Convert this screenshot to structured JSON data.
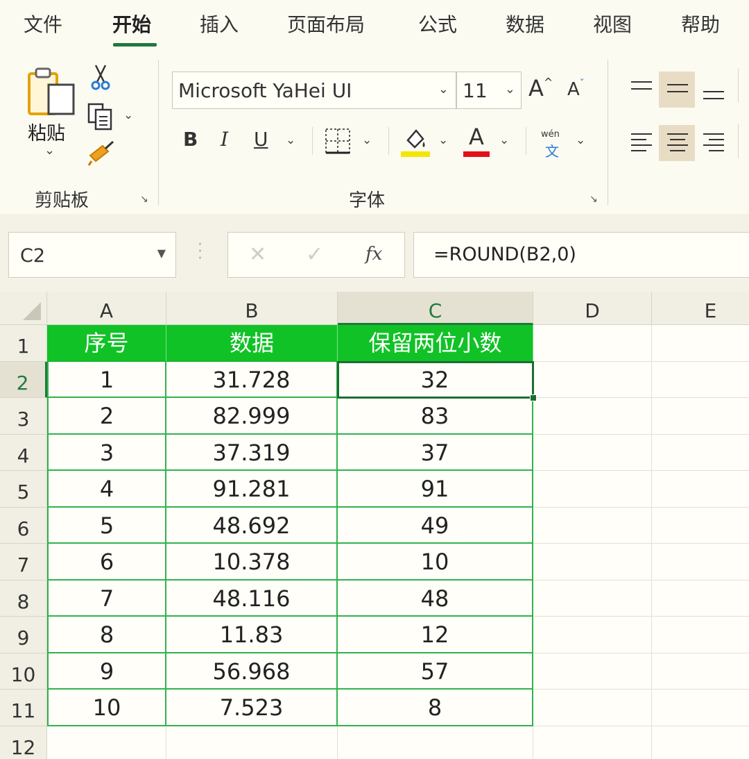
{
  "ribbon_tabs": [
    "文件",
    "开始",
    "插入",
    "页面布局",
    "公式",
    "数据",
    "视图",
    "帮助"
  ],
  "active_tab": "开始",
  "clipboard": {
    "paste_label": "粘贴",
    "group_label": "剪贴板"
  },
  "font": {
    "name": "Microsoft YaHei UI",
    "size": "11",
    "grow_label": "A",
    "shrink_label": "A",
    "bold_label": "B",
    "italic_label": "I",
    "underline_label": "U",
    "font_color_label": "A",
    "phonetic_top": "wén",
    "phonetic_bottom": "文",
    "group_label": "字体",
    "highlight_color": "#f4e600",
    "font_color": "#e3101a"
  },
  "formula_bar": {
    "name_box": "C2",
    "fx_label": "fx",
    "formula": "=ROUND(B2,0)"
  },
  "sheet": {
    "columns": [
      "A",
      "B",
      "C",
      "D",
      "E"
    ],
    "row_numbers": [
      "1",
      "2",
      "3",
      "4",
      "5",
      "6",
      "7",
      "8",
      "9",
      "10",
      "11",
      "12"
    ],
    "selected_column": "C",
    "selected_row": "2",
    "header_row": [
      "序号",
      "数据",
      "保留两位小数"
    ],
    "rows": [
      [
        "1",
        "31.728",
        "32"
      ],
      [
        "2",
        "82.999",
        "83"
      ],
      [
        "3",
        "37.319",
        "37"
      ],
      [
        "4",
        "91.281",
        "91"
      ],
      [
        "5",
        "48.692",
        "49"
      ],
      [
        "6",
        "10.378",
        "10"
      ],
      [
        "7",
        "48.116",
        "48"
      ],
      [
        "8",
        "11.83",
        "12"
      ],
      [
        "9",
        "56.968",
        "57"
      ],
      [
        "10",
        "7.523",
        "8"
      ]
    ],
    "header_color": "#11c226",
    "table_border_color": "#2fb34c"
  }
}
